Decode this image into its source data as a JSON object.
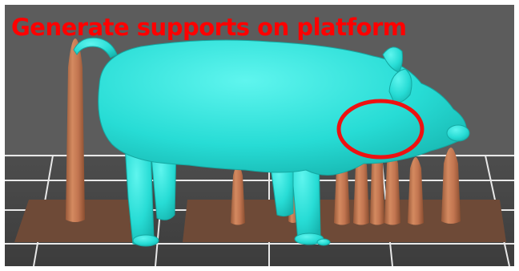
{
  "caption": {
    "text": "Generate supports on platform",
    "color": "#ff0000"
  },
  "scene": {
    "model_color": "#2ee8e0",
    "support_color": "#c87a52",
    "raft_color": "#6e4a37",
    "grid_line_color": "#e8e8e8",
    "bed_color": "#4d4d4d",
    "highlight_ring_color": "#ee1111",
    "icons": [
      "pig-model",
      "support-pillar",
      "support-raft",
      "highlight-circle"
    ]
  }
}
